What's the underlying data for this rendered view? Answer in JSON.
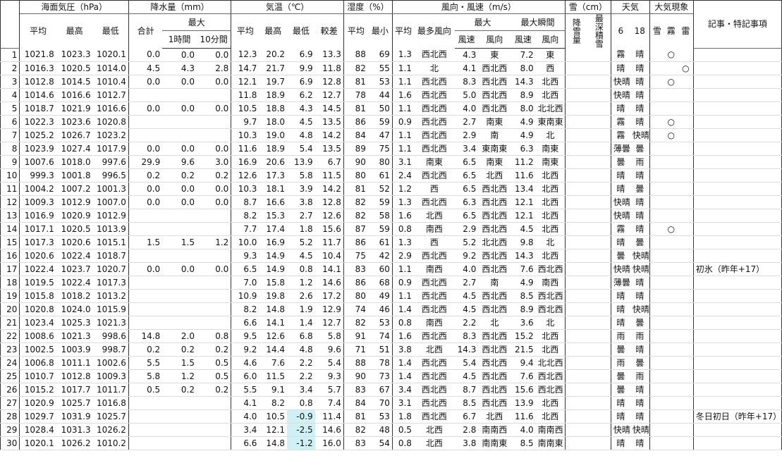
{
  "header": {
    "pressure": "海面気圧（hPa）",
    "precip": "降水量（mm）",
    "temp": "気温（℃）",
    "humidity": "湿度（%）",
    "wind": "風向・風速（m/s）",
    "snow": "雪（cm）",
    "weather": "天気",
    "phenomena": "大気現象",
    "notes": "記事・特記事項",
    "max": "最大",
    "max_gust": "最大瞬間",
    "avg": "平均",
    "high": "最高",
    "low": "最低",
    "total": "合計",
    "hour1": "1時間",
    "min10": "10分間",
    "range": "較差",
    "min": "最小",
    "mode_dir": "最多風向",
    "speed": "風速",
    "dir": "風向",
    "snowfall": "降雪量",
    "snowdepth": "最深積雪",
    "w6": "6",
    "w18": "18",
    "ph_snow": "雪",
    "ph_fog": "霧",
    "ph_thunder": "雷"
  },
  "rows": [
    {
      "d": "1",
      "pa": "1021.8",
      "ph": "1023.3",
      "pl": "1020.1",
      "rt": "0.0",
      "r1": "0.0",
      "r10": "0.0",
      "ta": "12.3",
      "th": "20.2",
      "tl": "6.9",
      "tr": "13.3",
      "ha": "88",
      "hm": "69",
      "wa": "1.3",
      "wd": "西北西",
      "ws": "4.3",
      "wsd": "東",
      "wg": "7.2",
      "wgd": "東",
      "w6": "霧",
      "w6c": "fog",
      "w18": "晴",
      "w18c": "fine",
      "fog": "○",
      "thu": "",
      "note": ""
    },
    {
      "d": "2",
      "pa": "1016.3",
      "ph": "1020.5",
      "pl": "1014.0",
      "rt": "4.5",
      "r1": "4.3",
      "r10": "2.8",
      "ta": "14.7",
      "th": "21.7",
      "tl": "9.9",
      "tr": "11.8",
      "ha": "82",
      "hm": "55",
      "wa": "1.1",
      "wd": "北",
      "ws": "4.1",
      "wsd": "西北西",
      "wg": "8.0",
      "wgd": "西",
      "w6": "晴",
      "w6c": "fine",
      "w18": "晴",
      "w18c": "fine",
      "fog": "",
      "thu": "○",
      "note": ""
    },
    {
      "d": "3",
      "pa": "1012.8",
      "ph": "1014.5",
      "pl": "1010.4",
      "rt": "0.0",
      "r1": "0.0",
      "r10": "0.0",
      "ta": "12.1",
      "th": "19.7",
      "tl": "6.9",
      "tr": "12.8",
      "ha": "81",
      "hm": "53",
      "wa": "1.1",
      "wd": "西北西",
      "ws": "8.3",
      "wsd": "西北西",
      "wg": "14.3",
      "wgd": "北西",
      "w6": "快晴",
      "w6c": "fine",
      "w18": "晴",
      "w18c": "fine",
      "fog": "○",
      "thu": "",
      "note": ""
    },
    {
      "d": "4",
      "pa": "1014.6",
      "ph": "1016.6",
      "pl": "1012.7",
      "rt": "",
      "r1": "",
      "r10": "",
      "ta": "11.8",
      "th": "18.9",
      "tl": "6.2",
      "tr": "12.7",
      "ha": "78",
      "hm": "44",
      "wa": "1.6",
      "wd": "西北西",
      "ws": "5.0",
      "wsd": "西北西",
      "wg": "8.9",
      "wgd": "北西",
      "w6": "快晴",
      "w6c": "fine",
      "w18": "晴",
      "w18c": "fine",
      "fog": "",
      "thu": "",
      "note": ""
    },
    {
      "d": "5",
      "pa": "1018.7",
      "ph": "1021.9",
      "pl": "1016.6",
      "rt": "0.0",
      "r1": "0.0",
      "r10": "0.0",
      "ta": "10.5",
      "th": "18.8",
      "tl": "4.3",
      "tr": "14.5",
      "ha": "81",
      "hm": "50",
      "wa": "1.1",
      "wd": "西北西",
      "ws": "4.0",
      "wsd": "西北西",
      "wg": "8.0",
      "wgd": "北北西",
      "w6": "晴",
      "w6c": "fine",
      "w18": "晴",
      "w18c": "fine",
      "fog": "",
      "thu": "",
      "note": ""
    },
    {
      "d": "6",
      "pa": "1022.3",
      "ph": "1023.6",
      "pl": "1020.8",
      "rt": "",
      "r1": "",
      "r10": "",
      "ta": "9.7",
      "th": "18.0",
      "tl": "4.5",
      "tr": "13.5",
      "ha": "86",
      "hm": "59",
      "wa": "0.9",
      "wd": "西北西",
      "ws": "2.7",
      "wsd": "南東",
      "wg": "4.9",
      "wgd": "東南東",
      "w6": "霧",
      "w6c": "fog",
      "w18": "晴",
      "w18c": "fine",
      "fog": "○",
      "thu": "",
      "note": ""
    },
    {
      "d": "7",
      "pa": "1025.2",
      "ph": "1026.7",
      "pl": "1023.2",
      "rt": "",
      "r1": "",
      "r10": "",
      "ta": "10.3",
      "th": "19.0",
      "tl": "4.8",
      "tr": "14.2",
      "ha": "84",
      "hm": "47",
      "wa": "1.1",
      "wd": "西北西",
      "ws": "2.9",
      "wsd": "南",
      "wg": "4.9",
      "wgd": "北",
      "w6": "霧",
      "w6c": "fog",
      "w18": "快晴",
      "w18c": "fine",
      "fog": "○",
      "thu": "",
      "note": ""
    },
    {
      "d": "8",
      "pa": "1023.9",
      "ph": "1027.4",
      "pl": "1017.9",
      "rt": "0.0",
      "r1": "0.0",
      "r10": "0.0",
      "ta": "11.6",
      "th": "18.9",
      "tl": "5.4",
      "tr": "13.5",
      "ha": "89",
      "hm": "75",
      "wa": "1.1",
      "wd": "西北西",
      "ws": "3.4",
      "wsd": "東南東",
      "wg": "6.3",
      "wgd": "南東",
      "w6": "薄曇",
      "w6c": "thin",
      "w18": "曇",
      "w18c": "cloud",
      "fog": "",
      "thu": "",
      "note": ""
    },
    {
      "d": "9",
      "pa": "1007.6",
      "ph": "1018.0",
      "pl": "997.6",
      "rt": "29.9",
      "r1": "9.6",
      "r10": "3.0",
      "ta": "16.9",
      "th": "20.6",
      "tl": "13.9",
      "tr": "6.7",
      "ha": "90",
      "hm": "80",
      "wa": "3.1",
      "wd": "南東",
      "ws": "6.5",
      "wsd": "南東",
      "wg": "11.2",
      "wgd": "南東",
      "w6": "曇",
      "w6c": "cloud",
      "w18": "雨",
      "w18c": "rain",
      "fog": "",
      "thu": "",
      "note": ""
    },
    {
      "d": "10",
      "pa": "999.3",
      "ph": "1001.8",
      "pl": "996.5",
      "rt": "0.2",
      "r1": "0.2",
      "r10": "0.2",
      "ta": "12.6",
      "th": "17.3",
      "tl": "5.8",
      "tr": "11.5",
      "ha": "80",
      "hm": "61",
      "wa": "2.4",
      "wd": "西北西",
      "ws": "6.5",
      "wsd": "北西",
      "wg": "11.6",
      "wgd": "北西",
      "w6": "晴",
      "w6c": "fine",
      "w18": "晴",
      "w18c": "fine",
      "fog": "",
      "thu": "",
      "note": ""
    },
    {
      "d": "11",
      "pa": "1004.2",
      "ph": "1007.2",
      "pl": "1001.3",
      "rt": "0.0",
      "r1": "0.0",
      "r10": "0.0",
      "ta": "10.3",
      "th": "18.1",
      "tl": "3.9",
      "tr": "14.2",
      "ha": "81",
      "hm": "52",
      "wa": "1.2",
      "wd": "西",
      "ws": "6.5",
      "wsd": "西北西",
      "wg": "13.4",
      "wgd": "北西",
      "w6": "晴",
      "w6c": "fine",
      "w18": "曇",
      "w18c": "cloud",
      "fog": "",
      "thu": "",
      "note": ""
    },
    {
      "d": "12",
      "pa": "1009.3",
      "ph": "1012.9",
      "pl": "1007.0",
      "rt": "0.0",
      "r1": "0.0",
      "r10": "0.0",
      "ta": "8.7",
      "th": "16.6",
      "tl": "3.8",
      "tr": "12.8",
      "ha": "82",
      "hm": "59",
      "wa": "1.3",
      "wd": "西北西",
      "ws": "6.3",
      "wsd": "西北西",
      "wg": "12.1",
      "wgd": "北西",
      "w6": "快晴",
      "w6c": "fine",
      "w18": "晴",
      "w18c": "fine",
      "fog": "",
      "thu": "",
      "note": ""
    },
    {
      "d": "13",
      "pa": "1016.9",
      "ph": "1020.9",
      "pl": "1012.9",
      "rt": "",
      "r1": "",
      "r10": "",
      "ta": "8.2",
      "th": "15.3",
      "tl": "2.7",
      "tr": "12.6",
      "ha": "82",
      "hm": "58",
      "wa": "1.6",
      "wd": "北西",
      "ws": "6.5",
      "wsd": "西北西",
      "wg": "12.1",
      "wgd": "北西",
      "w6": "快晴",
      "w6c": "fine",
      "w18": "晴",
      "w18c": "fine",
      "fog": "",
      "thu": "",
      "note": ""
    },
    {
      "d": "14",
      "pa": "1017.1",
      "ph": "1020.5",
      "pl": "1013.9",
      "rt": "",
      "r1": "",
      "r10": "",
      "ta": "7.7",
      "th": "17.4",
      "tl": "1.8",
      "tr": "15.6",
      "ha": "87",
      "hm": "59",
      "wa": "0.8",
      "wd": "南西",
      "ws": "2.9",
      "wsd": "西北西",
      "wg": "4.5",
      "wgd": "北西",
      "w6": "霧",
      "w6c": "fog",
      "w18": "晴",
      "w18c": "fine",
      "fog": "○",
      "thu": "",
      "note": ""
    },
    {
      "d": "15",
      "pa": "1017.3",
      "ph": "1020.6",
      "pl": "1015.1",
      "rt": "1.5",
      "r1": "1.5",
      "r10": "1.2",
      "ta": "10.0",
      "th": "16.9",
      "tl": "5.2",
      "tr": "11.7",
      "ha": "86",
      "hm": "61",
      "wa": "1.3",
      "wd": "西",
      "ws": "5.2",
      "wsd": "北北西",
      "wg": "9.8",
      "wgd": "北",
      "w6": "晴",
      "w6c": "fine",
      "w18": "曇",
      "w18c": "cloud",
      "fog": "",
      "thu": "",
      "note": ""
    },
    {
      "d": "16",
      "pa": "1020.6",
      "ph": "1022.4",
      "pl": "1018.7",
      "rt": "",
      "r1": "",
      "r10": "",
      "ta": "9.3",
      "th": "14.9",
      "tl": "4.5",
      "tr": "10.4",
      "ha": "75",
      "hm": "42",
      "wa": "2.9",
      "wd": "西北西",
      "ws": "9.2",
      "wsd": "西北西",
      "wg": "14.3",
      "wgd": "北西",
      "w6": "曇",
      "w6c": "cloud",
      "w18": "快晴",
      "w18c": "fine",
      "fog": "",
      "thu": "",
      "note": ""
    },
    {
      "d": "17",
      "pa": "1022.4",
      "ph": "1023.7",
      "pl": "1020.7",
      "rt": "0.0",
      "r1": "0.0",
      "r10": "0.0",
      "ta": "6.5",
      "th": "14.9",
      "tl": "0.8",
      "tr": "14.1",
      "ha": "83",
      "hm": "60",
      "wa": "1.1",
      "wd": "南西",
      "ws": "4.0",
      "wsd": "西北西",
      "wg": "7.6",
      "wgd": "西北西",
      "w6": "快晴",
      "w6c": "fine",
      "w18": "快晴",
      "w18c": "fine",
      "fog": "",
      "thu": "",
      "note": "初氷（昨年+17）"
    },
    {
      "d": "18",
      "pa": "1019.5",
      "ph": "1022.4",
      "pl": "1017.3",
      "rt": "",
      "r1": "",
      "r10": "",
      "ta": "7.0",
      "th": "15.8",
      "tl": "1.2",
      "tr": "14.6",
      "ha": "86",
      "hm": "68",
      "wa": "0.9",
      "wd": "西北西",
      "ws": "2.7",
      "wsd": "南",
      "wg": "4.9",
      "wgd": "南西",
      "w6": "薄曇",
      "w6c": "thin",
      "w18": "晴",
      "w18c": "fine",
      "fog": "",
      "thu": "",
      "note": ""
    },
    {
      "d": "19",
      "pa": "1015.8",
      "ph": "1018.2",
      "pl": "1013.2",
      "rt": "",
      "r1": "",
      "r10": "",
      "ta": "10.9",
      "th": "19.8",
      "tl": "2.6",
      "tr": "17.2",
      "ha": "80",
      "hm": "49",
      "wa": "1.1",
      "wd": "西北西",
      "ws": "4.5",
      "wsd": "西北西",
      "wg": "8.5",
      "wgd": "西北西",
      "w6": "晴",
      "w6c": "fine",
      "w18": "晴",
      "w18c": "fine",
      "fog": "",
      "thu": "",
      "note": ""
    },
    {
      "d": "20",
      "pa": "1020.8",
      "ph": "1024.0",
      "pl": "1015.9",
      "rt": "",
      "r1": "",
      "r10": "",
      "ta": "8.2",
      "th": "14.8",
      "tl": "1.9",
      "tr": "12.9",
      "ha": "74",
      "hm": "46",
      "wa": "1.4",
      "wd": "西北西",
      "ws": "4.5",
      "wsd": "西北西",
      "wg": "8.9",
      "wgd": "西北西",
      "w6": "晴",
      "w6c": "fine",
      "w18": "快晴",
      "w18c": "fine",
      "fog": "",
      "thu": "",
      "note": ""
    },
    {
      "d": "21",
      "pa": "1023.4",
      "ph": "1025.3",
      "pl": "1021.3",
      "rt": "",
      "r1": "",
      "r10": "",
      "ta": "6.6",
      "th": "14.1",
      "tl": "1.4",
      "tr": "12.7",
      "ha": "82",
      "hm": "53",
      "wa": "0.8",
      "wd": "南西",
      "ws": "2.2",
      "wsd": "北",
      "wg": "3.6",
      "wgd": "北",
      "w6": "晴",
      "w6c": "fine",
      "w18": "曇",
      "w18c": "cloud",
      "fog": "",
      "thu": "",
      "note": ""
    },
    {
      "d": "22",
      "pa": "1008.6",
      "ph": "1021.3",
      "pl": "998.6",
      "rt": "14.8",
      "r1": "2.0",
      "r10": "0.8",
      "ta": "9.5",
      "th": "12.6",
      "tl": "6.8",
      "tr": "5.8",
      "ha": "91",
      "hm": "74",
      "wa": "1.6",
      "wd": "西北西",
      "ws": "8.3",
      "wsd": "西北西",
      "wg": "15.2",
      "wgd": "北西",
      "w6": "雨",
      "w6c": "rain",
      "w18": "雨",
      "w18c": "rain",
      "fog": "",
      "thu": "",
      "note": ""
    },
    {
      "d": "23",
      "pa": "1002.5",
      "ph": "1003.9",
      "pl": "998.7",
      "rt": "0.2",
      "r1": "0.2",
      "r10": "0.2",
      "ta": "9.2",
      "th": "14.4",
      "tl": "4.8",
      "tr": "9.6",
      "ha": "71",
      "hm": "51",
      "wa": "3.8",
      "wd": "北西",
      "ws": "14.3",
      "wsd": "西北西",
      "wg": "21.5",
      "wgd": "北西",
      "w6": "曇",
      "w6c": "cloud",
      "w18": "晴",
      "w18c": "fine",
      "fog": "",
      "thu": "",
      "note": ""
    },
    {
      "d": "24",
      "pa": "1006.8",
      "ph": "1011.1",
      "pl": "1002.6",
      "rt": "5.5",
      "r1": "1.5",
      "r10": "0.5",
      "ta": "4.6",
      "th": "7.6",
      "tl": "2.2",
      "tr": "5.4",
      "ha": "88",
      "hm": "78",
      "wa": "1.4",
      "wd": "西北西",
      "ws": "5.4",
      "wsd": "西北西",
      "wg": "9.4",
      "wgd": "北北西",
      "w6": "雨",
      "w6c": "rain",
      "w18": "曇",
      "w18c": "cloud",
      "fog": "",
      "thu": "",
      "note": ""
    },
    {
      "d": "25",
      "pa": "1010.7",
      "ph": "1012.8",
      "pl": "1009.3",
      "rt": "5.8",
      "r1": "1.2",
      "r10": "0.5",
      "ta": "6.0",
      "th": "11.5",
      "tl": "2.2",
      "tr": "9.3",
      "ha": "90",
      "hm": "73",
      "wa": "1.4",
      "wd": "西北西",
      "ws": "4.5",
      "wsd": "西北西",
      "wg": "7.6",
      "wgd": "西北西",
      "w6": "曇",
      "w6c": "cloud",
      "w18": "雨",
      "w18c": "rain",
      "fog": "",
      "thu": "",
      "note": ""
    },
    {
      "d": "26",
      "pa": "1015.2",
      "ph": "1017.7",
      "pl": "1011.7",
      "rt": "0.5",
      "r1": "0.2",
      "r10": "0.2",
      "ta": "5.5",
      "th": "9.1",
      "tl": "3.4",
      "tr": "5.7",
      "ha": "83",
      "hm": "67",
      "wa": "3.4",
      "wd": "西北西",
      "ws": "8.7",
      "wsd": "西北西",
      "wg": "15.6",
      "wgd": "西北西",
      "w6": "曇",
      "w6c": "cloud",
      "w18": "晴",
      "w18c": "fine",
      "fog": "",
      "thu": "",
      "note": ""
    },
    {
      "d": "27",
      "pa": "1020.9",
      "ph": "1025.7",
      "pl": "1016.8",
      "rt": "",
      "r1": "",
      "r10": "",
      "ta": "4.1",
      "th": "8.2",
      "tl": "0.8",
      "tr": "7.4",
      "ha": "84",
      "hm": "70",
      "wa": "3.1",
      "wd": "西北西",
      "ws": "8.5",
      "wsd": "西北西",
      "wg": "13.9",
      "wgd": "北西",
      "w6": "晴",
      "w6c": "fine",
      "w18": "晴",
      "w18c": "fine",
      "fog": "",
      "thu": "",
      "note": ""
    },
    {
      "d": "28",
      "pa": "1029.7",
      "ph": "1031.9",
      "pl": "1025.7",
      "rt": "",
      "r1": "",
      "r10": "",
      "ta": "4.0",
      "th": "10.5",
      "tl": "-0.9",
      "tr": "11.4",
      "ha": "81",
      "hm": "53",
      "wa": "1.8",
      "wd": "西北西",
      "ws": "6.7",
      "wsd": "北西",
      "wg": "11.6",
      "wgd": "北西",
      "w6": "晴",
      "w6c": "fine",
      "w18": "晴",
      "w18c": "fine",
      "fog": "",
      "thu": "",
      "note": "冬日初日（昨年+17）"
    },
    {
      "d": "29",
      "pa": "1028.4",
      "ph": "1031.3",
      "pl": "1026.2",
      "rt": "",
      "r1": "",
      "r10": "",
      "ta": "3.4",
      "th": "12.1",
      "tl": "-2.5",
      "tr": "14.6",
      "ha": "82",
      "hm": "48",
      "wa": "0.5",
      "wd": "北西",
      "ws": "2.8",
      "wsd": "南南西",
      "wg": "4.0",
      "wgd": "南南西",
      "w6": "快晴",
      "w6c": "fine",
      "w18": "快晴",
      "w18c": "fine",
      "fog": "",
      "thu": "",
      "note": ""
    },
    {
      "d": "30",
      "pa": "1020.1",
      "ph": "1026.2",
      "pl": "1010.2",
      "rt": "",
      "r1": "",
      "r10": "",
      "ta": "6.6",
      "th": "14.8",
      "tl": "-1.2",
      "tr": "16.0",
      "ha": "83",
      "hm": "54",
      "wa": "0.8",
      "wd": "北西",
      "ws": "3.8",
      "wsd": "南南東",
      "wg": "8.5",
      "wgd": "南南東",
      "w6": "晴",
      "w6c": "fine",
      "w18": "晴",
      "w18c": "fine",
      "fog": "",
      "thu": "",
      "note": ""
    }
  ]
}
